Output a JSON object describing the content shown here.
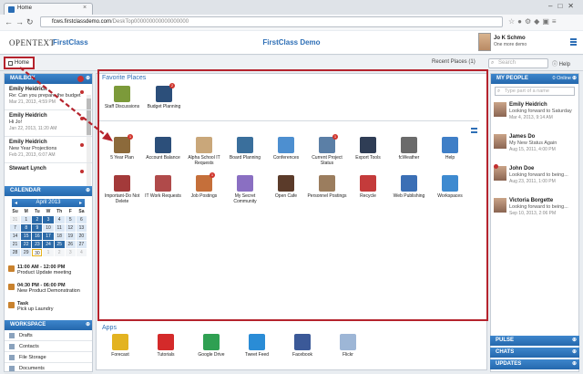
{
  "browser": {
    "tab_title": "Home",
    "url_prefix": "fcws.firstclassdemo.com",
    "url_path": "/DeskTop000000000000000000"
  },
  "header": {
    "logo_opentext": "OPENTEXT",
    "logo_firstclass": "FirstClass",
    "title": "FirstClass Demo",
    "user_name": "Jo K Schmo",
    "user_status": "One more demo"
  },
  "toolbar": {
    "home_label": "Home",
    "recent_label": "Recent Places (1)",
    "search_placeholder": "Search",
    "help_label": "Help"
  },
  "mailbox": {
    "title": "MAILBOX",
    "items": [
      {
        "from": "Emily Heidrich",
        "subject": "Re: Can you prepare the budget",
        "date": "Mar 21, 2013, 4:59 PM"
      },
      {
        "from": "Emily Heidrich",
        "subject": "Hi Jo!",
        "date": "Jan 22, 2013, 11:20 AM"
      },
      {
        "from": "Emily Heidrich",
        "subject": "New Year Projections",
        "date": "Feb 21, 2013, 6:07 AM"
      },
      {
        "from": "Stewart Lynch",
        "subject": "",
        "date": ""
      }
    ]
  },
  "calendar": {
    "title": "CALENDAR",
    "month_label": "April 2013",
    "day_headers": [
      "Su",
      "M",
      "Tu",
      "W",
      "Th",
      "F",
      "Sa"
    ],
    "days": [
      "31",
      "1",
      "2",
      "3",
      "4",
      "5",
      "6",
      "7",
      "8",
      "9",
      "10",
      "11",
      "12",
      "13",
      "14",
      "15",
      "16",
      "17",
      "18",
      "19",
      "20",
      "21",
      "22",
      "23",
      "24",
      "25",
      "26",
      "27",
      "28",
      "29",
      "30",
      "1",
      "2",
      "3",
      "4"
    ],
    "events": [
      {
        "time": "11:00 AM - 12:00 PM",
        "title": "Product Update meeting"
      },
      {
        "time": "04:30 PM - 06:00 PM",
        "title": "New Product Demonstration"
      },
      {
        "time": "Task",
        "title": "Pick up Laundry"
      }
    ]
  },
  "workspace": {
    "title": "WORKSPACE",
    "items": [
      "Drafts",
      "Contacts",
      "File Storage",
      "Documents"
    ]
  },
  "favorites": {
    "title": "Favorite Places",
    "items": [
      {
        "label": "Staff Discussions",
        "icon": "discussion-icon"
      },
      {
        "label": "Budget Planning",
        "icon": "calculator-icon",
        "badge": "2"
      }
    ]
  },
  "tools": {
    "row1": [
      {
        "label": "5 Year Plan",
        "icon": "plan-icon",
        "badge": "1"
      },
      {
        "label": "Account Balance",
        "icon": "calculator-icon"
      },
      {
        "label": "Alpha School IT Requests",
        "icon": "request-icon"
      },
      {
        "label": "Board Planning",
        "icon": "board-icon"
      },
      {
        "label": "Conferences",
        "icon": "people-icon"
      },
      {
        "label": "Current Project Status",
        "icon": "status-icon",
        "badge": "1"
      },
      {
        "label": "Export Tools",
        "icon": "monitor-icon"
      },
      {
        "label": "fcWeather",
        "icon": "weather-icon"
      },
      {
        "label": "Help",
        "icon": "help-icon"
      }
    ],
    "row2": [
      {
        "label": "Important-Do Not Delete",
        "icon": "important-icon"
      },
      {
        "label": "IT Work Requests",
        "icon": "pencil-icon"
      },
      {
        "label": "Job Postings",
        "icon": "folder-icon",
        "badge": "1"
      },
      {
        "label": "My Secret Community",
        "icon": "community-icon"
      },
      {
        "label": "Open Cafe",
        "icon": "cafe-icon"
      },
      {
        "label": "Personnel Postings",
        "icon": "personnel-icon"
      },
      {
        "label": "Recycle",
        "icon": "recycle-icon"
      },
      {
        "label": "Web Publishing",
        "icon": "web-icon"
      },
      {
        "label": "Workspaces",
        "icon": "workspaces-icon"
      }
    ]
  },
  "apps": {
    "title": "Apps",
    "items": [
      {
        "label": "Forecast",
        "icon": "forecast-icon"
      },
      {
        "label": "Tutorials",
        "icon": "youtube-icon"
      },
      {
        "label": "Google Drive",
        "icon": "drive-icon"
      },
      {
        "label": "Tweet Feed",
        "icon": "twitter-icon"
      },
      {
        "label": "Facebook",
        "icon": "facebook-icon"
      },
      {
        "label": "Flickr",
        "icon": "flickr-icon"
      }
    ]
  },
  "people": {
    "title": "MY PEOPLE",
    "online": "0 Online",
    "search_placeholder": "Type part of a name",
    "items": [
      {
        "name": "Emily Heidrich",
        "status": "Looking forward to Saturday",
        "date": "Mar 4, 2013, 9:14 AM"
      },
      {
        "name": "James Do",
        "status": "My New Status Again",
        "date": "Aug 15, 2011, 4:00 PM"
      },
      {
        "name": "John Doe",
        "status": "Looking forward to being...",
        "date": "Aug 23, 2011, 1:00 PM"
      },
      {
        "name": "Victoria Borgette",
        "status": "Looking forward to being...",
        "date": "Sep 10, 2013, 2:06 PM"
      }
    ]
  },
  "right_bars": [
    "PULSE",
    "CHATS",
    "UPDATES"
  ],
  "colors": {
    "accent": "#2e6fb6",
    "highlight_red": "#b5232d",
    "panel_header": "#2568ad"
  }
}
